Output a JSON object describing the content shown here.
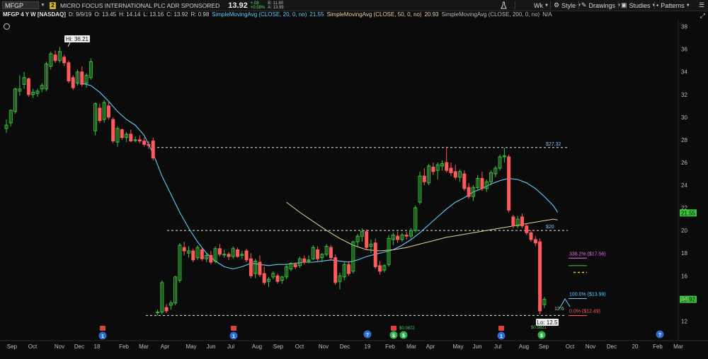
{
  "toolbar": {
    "symbol": "MFGP",
    "badge": "2",
    "company": "MICRO FOCUS INTERNATIONAL PLC ADR SPONSORED",
    "last": "13.92",
    "change": "+.08",
    "change_pct": "+0.58%",
    "bid": "B: 11.80",
    "ask": "A: 13.99",
    "interval": "Wk",
    "style_label": "Style",
    "drawings_label": "Drawings",
    "studies_label": "Studies",
    "patterns_label": "Patterns"
  },
  "infobar": {
    "title": "MFGP 4 Y W [NASDAQ]",
    "date": "D: 9/9/19",
    "open": "O: 13.45",
    "high": "H: 14.14",
    "low": "L: 13.16",
    "close": "C: 13.92",
    "range": "R: 0.98",
    "sma20_label": "SimpleMovingAvg (CLOSE, 20, 0, no)",
    "sma20_value": "21.55",
    "sma50_label": "SimpleMovingAvg (CLOSE, 50, 0, no)",
    "sma50_value": "20.93",
    "sma200_label": "SimpleMovingAvg (CLOSE, 200, 0, no)",
    "sma200_value": "N/A"
  },
  "colors": {
    "background": "#0b0b0b",
    "up_candle": "#39c43b",
    "down_candle": "#ff5b5b",
    "sma20": "#5fd0ff",
    "sma50": "#e8d49a",
    "price_tag": "#39c43b",
    "accent_yellow": "#e6c830"
  },
  "chart_data": {
    "type": "candlestick",
    "ylim": [
      11.4,
      38.6
    ],
    "y_ticks": [
      "38",
      "36",
      "34",
      "32",
      "30",
      "28",
      "26",
      "24",
      "22",
      "20",
      "18",
      "16",
      "14",
      "12"
    ],
    "x_labels": [
      "Sep",
      "Oct",
      "Nov",
      "Dec",
      "18",
      "Feb",
      "Mar",
      "Apr",
      "May",
      "Jun",
      "Jul",
      "Aug",
      "Sep",
      "Oct",
      "Nov",
      "Dec",
      "19",
      "Feb",
      "Mar",
      "Apr",
      "May",
      "Jun",
      "Jul",
      "Aug",
      "Sep",
      "Oct",
      "Nov",
      "Dec",
      "20",
      "Feb",
      "Mar"
    ],
    "candles": [
      {
        "o": 29.0,
        "h": 29.8,
        "l": 28.6,
        "c": 29.3
      },
      {
        "o": 29.5,
        "h": 30.7,
        "l": 29.2,
        "c": 30.6
      },
      {
        "o": 30.5,
        "h": 32.6,
        "l": 30.3,
        "c": 32.5
      },
      {
        "o": 32.3,
        "h": 33.7,
        "l": 31.9,
        "c": 32.5
      },
      {
        "o": 32.9,
        "h": 34.0,
        "l": 32.5,
        "c": 33.5
      },
      {
        "o": 33.4,
        "h": 33.5,
        "l": 31.8,
        "c": 32.0
      },
      {
        "o": 32.0,
        "h": 32.5,
        "l": 31.7,
        "c": 32.2
      },
      {
        "o": 32.1,
        "h": 32.5,
        "l": 31.8,
        "c": 32.3
      },
      {
        "o": 32.5,
        "h": 33.0,
        "l": 32.2,
        "c": 32.8
      },
      {
        "o": 32.5,
        "h": 34.9,
        "l": 32.3,
        "c": 34.7
      },
      {
        "o": 34.5,
        "h": 35.8,
        "l": 34.2,
        "c": 35.6
      },
      {
        "o": 35.5,
        "h": 35.9,
        "l": 34.8,
        "c": 35.0
      },
      {
        "o": 35.0,
        "h": 36.21,
        "l": 34.8,
        "c": 35.8
      },
      {
        "o": 35.3,
        "h": 35.5,
        "l": 34.5,
        "c": 34.8
      },
      {
        "o": 34.8,
        "h": 35.0,
        "l": 33.0,
        "c": 33.2
      },
      {
        "o": 33.5,
        "h": 33.7,
        "l": 32.4,
        "c": 32.6
      },
      {
        "o": 33.0,
        "h": 34.2,
        "l": 32.8,
        "c": 34.0
      },
      {
        "o": 34.0,
        "h": 34.5,
        "l": 32.7,
        "c": 32.9
      },
      {
        "o": 33.0,
        "h": 33.9,
        "l": 32.6,
        "c": 33.7
      },
      {
        "o": 33.5,
        "h": 35.2,
        "l": 33.3,
        "c": 34.9
      },
      {
        "o": 28.8,
        "h": 31.3,
        "l": 28.4,
        "c": 31.2
      },
      {
        "o": 30.8,
        "h": 31.2,
        "l": 29.5,
        "c": 29.7
      },
      {
        "o": 29.8,
        "h": 31.5,
        "l": 29.5,
        "c": 31.3
      },
      {
        "o": 31.0,
        "h": 31.4,
        "l": 29.8,
        "c": 30.0
      },
      {
        "o": 29.8,
        "h": 30.0,
        "l": 27.7,
        "c": 27.9
      },
      {
        "o": 27.8,
        "h": 29.2,
        "l": 27.4,
        "c": 29.0
      },
      {
        "o": 28.9,
        "h": 29.0,
        "l": 28.0,
        "c": 28.2
      },
      {
        "o": 28.2,
        "h": 28.7,
        "l": 27.8,
        "c": 28.5
      },
      {
        "o": 28.5,
        "h": 28.9,
        "l": 27.8,
        "c": 27.9
      },
      {
        "o": 28.0,
        "h": 28.3,
        "l": 27.8,
        "c": 28.0
      },
      {
        "o": 28.0,
        "h": 28.4,
        "l": 27.7,
        "c": 27.9
      },
      {
        "o": 27.9,
        "h": 28.2,
        "l": 27.4,
        "c": 27.6
      },
      {
        "o": 27.6,
        "h": 27.9,
        "l": 27.2,
        "c": 27.5
      },
      {
        "o": 27.9,
        "h": 28.2,
        "l": 26.2,
        "c": 26.4
      },
      {
        "o": 12.8,
        "h": 13.0,
        "l": 12.5,
        "c": 12.8
      },
      {
        "o": 12.8,
        "h": 15.6,
        "l": 12.6,
        "c": 15.4
      },
      {
        "o": 13.2,
        "h": 13.5,
        "l": 12.7,
        "c": 12.9
      },
      {
        "o": 13.4,
        "h": 13.8,
        "l": 13.0,
        "c": 13.6
      },
      {
        "o": 13.6,
        "h": 16.0,
        "l": 13.4,
        "c": 15.9
      },
      {
        "o": 15.6,
        "h": 18.9,
        "l": 15.4,
        "c": 18.7
      },
      {
        "o": 18.5,
        "h": 19.0,
        "l": 17.8,
        "c": 18.2
      },
      {
        "o": 18.0,
        "h": 18.6,
        "l": 17.6,
        "c": 18.2
      },
      {
        "o": 18.2,
        "h": 18.4,
        "l": 17.2,
        "c": 17.4
      },
      {
        "o": 17.6,
        "h": 18.7,
        "l": 17.4,
        "c": 18.5
      },
      {
        "o": 18.3,
        "h": 18.5,
        "l": 17.3,
        "c": 17.5
      },
      {
        "o": 17.5,
        "h": 18.0,
        "l": 17.2,
        "c": 17.8
      },
      {
        "o": 17.8,
        "h": 18.2,
        "l": 17.0,
        "c": 17.2
      },
      {
        "o": 17.3,
        "h": 18.6,
        "l": 17.1,
        "c": 18.4
      },
      {
        "o": 18.4,
        "h": 18.8,
        "l": 17.7,
        "c": 17.9
      },
      {
        "o": 17.9,
        "h": 18.3,
        "l": 17.6,
        "c": 17.9
      },
      {
        "o": 17.9,
        "h": 18.1,
        "l": 17.4,
        "c": 17.7
      },
      {
        "o": 17.7,
        "h": 18.6,
        "l": 17.5,
        "c": 18.4
      },
      {
        "o": 18.3,
        "h": 18.5,
        "l": 17.6,
        "c": 17.7
      },
      {
        "o": 17.8,
        "h": 18.2,
        "l": 17.5,
        "c": 17.9
      },
      {
        "o": 18.2,
        "h": 18.4,
        "l": 17.2,
        "c": 17.4
      },
      {
        "o": 17.5,
        "h": 18.0,
        "l": 15.8,
        "c": 16.0
      },
      {
        "o": 16.2,
        "h": 17.5,
        "l": 15.8,
        "c": 17.3
      },
      {
        "o": 17.2,
        "h": 17.8,
        "l": 15.9,
        "c": 16.1
      },
      {
        "o": 16.2,
        "h": 16.8,
        "l": 15.2,
        "c": 15.4
      },
      {
        "o": 15.5,
        "h": 15.9,
        "l": 15.0,
        "c": 15.7
      },
      {
        "o": 15.9,
        "h": 16.4,
        "l": 15.7,
        "c": 16.2
      },
      {
        "o": 16.0,
        "h": 16.2,
        "l": 15.3,
        "c": 15.5
      },
      {
        "o": 15.6,
        "h": 16.0,
        "l": 15.3,
        "c": 15.9
      },
      {
        "o": 15.9,
        "h": 17.0,
        "l": 15.7,
        "c": 16.8
      },
      {
        "o": 16.6,
        "h": 17.2,
        "l": 16.4,
        "c": 17.1
      },
      {
        "o": 17.0,
        "h": 17.2,
        "l": 16.6,
        "c": 16.8
      },
      {
        "o": 16.9,
        "h": 17.7,
        "l": 16.7,
        "c": 17.5
      },
      {
        "o": 17.5,
        "h": 17.8,
        "l": 17.0,
        "c": 17.2
      },
      {
        "o": 17.3,
        "h": 17.8,
        "l": 17.1,
        "c": 17.4
      },
      {
        "o": 17.5,
        "h": 18.7,
        "l": 17.4,
        "c": 18.5
      },
      {
        "o": 18.3,
        "h": 18.6,
        "l": 17.3,
        "c": 17.5
      },
      {
        "o": 17.6,
        "h": 18.0,
        "l": 17.2,
        "c": 17.9
      },
      {
        "o": 17.9,
        "h": 18.8,
        "l": 17.7,
        "c": 18.6
      },
      {
        "o": 18.5,
        "h": 18.7,
        "l": 17.4,
        "c": 17.6
      },
      {
        "o": 17.6,
        "h": 17.9,
        "l": 15.2,
        "c": 15.4
      },
      {
        "o": 15.5,
        "h": 16.3,
        "l": 14.8,
        "c": 16.0
      },
      {
        "o": 15.9,
        "h": 17.2,
        "l": 15.6,
        "c": 17.0
      },
      {
        "o": 17.0,
        "h": 17.3,
        "l": 16.0,
        "c": 16.2
      },
      {
        "o": 16.4,
        "h": 19.1,
        "l": 16.2,
        "c": 19.0
      },
      {
        "o": 19.0,
        "h": 19.7,
        "l": 18.5,
        "c": 19.5
      },
      {
        "o": 19.5,
        "h": 20.2,
        "l": 19.0,
        "c": 19.9
      },
      {
        "o": 19.9,
        "h": 20.1,
        "l": 18.3,
        "c": 18.5
      },
      {
        "o": 18.6,
        "h": 19.2,
        "l": 18.0,
        "c": 18.8
      },
      {
        "o": 18.9,
        "h": 19.3,
        "l": 16.6,
        "c": 16.8
      },
      {
        "o": 16.9,
        "h": 17.3,
        "l": 16.1,
        "c": 16.4
      },
      {
        "o": 16.5,
        "h": 17.0,
        "l": 16.3,
        "c": 16.9
      },
      {
        "o": 17.0,
        "h": 19.6,
        "l": 16.8,
        "c": 19.3
      },
      {
        "o": 19.2,
        "h": 19.8,
        "l": 18.7,
        "c": 19.6
      },
      {
        "o": 19.5,
        "h": 19.9,
        "l": 18.9,
        "c": 19.2
      },
      {
        "o": 19.2,
        "h": 19.8,
        "l": 19.0,
        "c": 19.6
      },
      {
        "o": 19.6,
        "h": 19.9,
        "l": 19.2,
        "c": 19.5
      },
      {
        "o": 19.5,
        "h": 20.2,
        "l": 19.3,
        "c": 20.0
      },
      {
        "o": 20.0,
        "h": 22.2,
        "l": 19.8,
        "c": 22.0
      },
      {
        "o": 22.5,
        "h": 25.2,
        "l": 22.3,
        "c": 24.8
      },
      {
        "o": 24.8,
        "h": 25.5,
        "l": 24.0,
        "c": 24.3
      },
      {
        "o": 24.2,
        "h": 25.9,
        "l": 24.0,
        "c": 25.7
      },
      {
        "o": 25.6,
        "h": 26.0,
        "l": 24.9,
        "c": 25.2
      },
      {
        "o": 25.3,
        "h": 26.0,
        "l": 24.5,
        "c": 25.8
      },
      {
        "o": 25.7,
        "h": 26.2,
        "l": 25.3,
        "c": 25.9
      },
      {
        "o": 26.0,
        "h": 27.4,
        "l": 25.1,
        "c": 25.3
      },
      {
        "o": 25.5,
        "h": 26.0,
        "l": 24.8,
        "c": 25.1
      },
      {
        "o": 25.2,
        "h": 25.8,
        "l": 24.5,
        "c": 24.7
      },
      {
        "o": 24.7,
        "h": 25.4,
        "l": 24.3,
        "c": 25.2
      },
      {
        "o": 25.0,
        "h": 25.3,
        "l": 23.5,
        "c": 23.7
      },
      {
        "o": 23.8,
        "h": 24.2,
        "l": 22.8,
        "c": 23.0
      },
      {
        "o": 23.0,
        "h": 24.0,
        "l": 22.6,
        "c": 23.8
      },
      {
        "o": 23.8,
        "h": 24.9,
        "l": 23.6,
        "c": 24.6
      },
      {
        "o": 24.6,
        "h": 25.2,
        "l": 23.5,
        "c": 23.7
      },
      {
        "o": 23.7,
        "h": 24.5,
        "l": 23.4,
        "c": 24.3
      },
      {
        "o": 24.3,
        "h": 25.3,
        "l": 24.0,
        "c": 25.1
      },
      {
        "o": 25.0,
        "h": 25.7,
        "l": 24.7,
        "c": 25.5
      },
      {
        "o": 25.5,
        "h": 26.7,
        "l": 25.3,
        "c": 26.5
      },
      {
        "o": 26.5,
        "h": 27.3,
        "l": 26.0,
        "c": 26.6
      },
      {
        "o": 26.5,
        "h": 26.7,
        "l": 21.6,
        "c": 21.8
      },
      {
        "o": 21.2,
        "h": 21.4,
        "l": 20.2,
        "c": 20.4
      },
      {
        "o": 20.4,
        "h": 21.3,
        "l": 20.2,
        "c": 21.0
      },
      {
        "o": 21.2,
        "h": 21.5,
        "l": 20.2,
        "c": 20.4
      },
      {
        "o": 20.4,
        "h": 20.6,
        "l": 19.6,
        "c": 19.8
      },
      {
        "o": 19.8,
        "h": 20.0,
        "l": 19.0,
        "c": 19.2
      },
      {
        "o": 19.2,
        "h": 19.5,
        "l": 18.6,
        "c": 18.9
      },
      {
        "o": 19.0,
        "h": 19.3,
        "l": 12.6,
        "c": 12.9
      },
      {
        "o": 13.45,
        "h": 14.14,
        "l": 13.16,
        "c": 13.92
      }
    ],
    "sma20": [
      [
        17,
        33.0
      ],
      [
        19,
        32.8
      ],
      [
        21,
        32.2
      ],
      [
        23,
        31.4
      ],
      [
        25,
        30.5
      ],
      [
        27,
        29.8
      ],
      [
        29,
        29.3
      ],
      [
        31,
        28.4
      ],
      [
        33,
        26.8
      ],
      [
        35,
        24.8
      ],
      [
        37,
        23.2
      ],
      [
        39,
        21.6
      ],
      [
        41,
        20.2
      ],
      [
        43,
        19.0
      ],
      [
        45,
        18.0
      ],
      [
        47,
        17.3
      ],
      [
        49,
        16.8
      ],
      [
        51,
        16.6
      ],
      [
        53,
        16.8
      ],
      [
        55,
        17.1
      ],
      [
        57,
        17.0
      ],
      [
        59,
        16.9
      ],
      [
        61,
        17.0
      ],
      [
        63,
        17.0
      ],
      [
        65,
        17.1
      ],
      [
        67,
        17.2
      ],
      [
        69,
        17.2
      ],
      [
        71,
        17.3
      ],
      [
        73,
        17.4
      ],
      [
        75,
        17.3
      ],
      [
        77,
        17.2
      ],
      [
        79,
        17.4
      ],
      [
        81,
        17.7
      ],
      [
        83,
        17.9
      ],
      [
        85,
        18.1
      ],
      [
        87,
        18.3
      ],
      [
        89,
        18.7
      ],
      [
        91,
        19.2
      ],
      [
        93,
        19.8
      ],
      [
        95,
        20.5
      ],
      [
        97,
        21.2
      ],
      [
        99,
        21.9
      ],
      [
        101,
        22.5
      ],
      [
        103,
        22.9
      ],
      [
        105,
        23.4
      ],
      [
        107,
        23.7
      ],
      [
        109,
        24.1
      ],
      [
        111,
        24.4
      ],
      [
        113,
        24.6
      ],
      [
        115,
        24.5
      ],
      [
        117,
        24.2
      ],
      [
        119,
        23.7
      ],
      [
        121,
        23.0
      ],
      [
        123,
        22.2
      ],
      [
        124,
        21.6
      ]
    ],
    "sma50": [
      [
        63,
        22.5
      ],
      [
        66,
        21.6
      ],
      [
        69,
        20.8
      ],
      [
        72,
        20.0
      ],
      [
        75,
        19.3
      ],
      [
        78,
        18.7
      ],
      [
        81,
        18.3
      ],
      [
        84,
        18.2
      ],
      [
        87,
        18.3
      ],
      [
        90,
        18.5
      ],
      [
        93,
        18.8
      ],
      [
        96,
        19.1
      ],
      [
        99,
        19.4
      ],
      [
        102,
        19.6
      ],
      [
        105,
        19.8
      ],
      [
        108,
        20.0
      ],
      [
        111,
        20.2
      ],
      [
        114,
        20.4
      ],
      [
        117,
        20.6
      ],
      [
        120,
        20.8
      ],
      [
        123,
        21.0
      ],
      [
        124,
        20.93
      ]
    ],
    "hlines": [
      {
        "value": 27.32,
        "label": "$27.32"
      },
      {
        "value": 20.0,
        "label": "$20"
      },
      {
        "value": 12.5,
        "label": ""
      }
    ],
    "fib": [
      {
        "value": 17.56,
        "pct": "338.2%",
        "price": "($17.56)",
        "color": "#e071e8"
      },
      {
        "value": 13.99,
        "pct": "100.0%",
        "price": "($13.99)",
        "color": "#5fd0ff"
      },
      {
        "value": 12.49,
        "pct": "0.0%",
        "price": "($12.49)",
        "color": "#ff5b5b"
      }
    ],
    "hi_label": "Hi: 36.21",
    "lo_label": "Lo: 12.5",
    "small_label": "12.6",
    "last_price_tag": "13.92",
    "sma_price_tag": "21.55",
    "event_text_1": "$0.0872",
    "event_text_2": "$0.5821"
  }
}
